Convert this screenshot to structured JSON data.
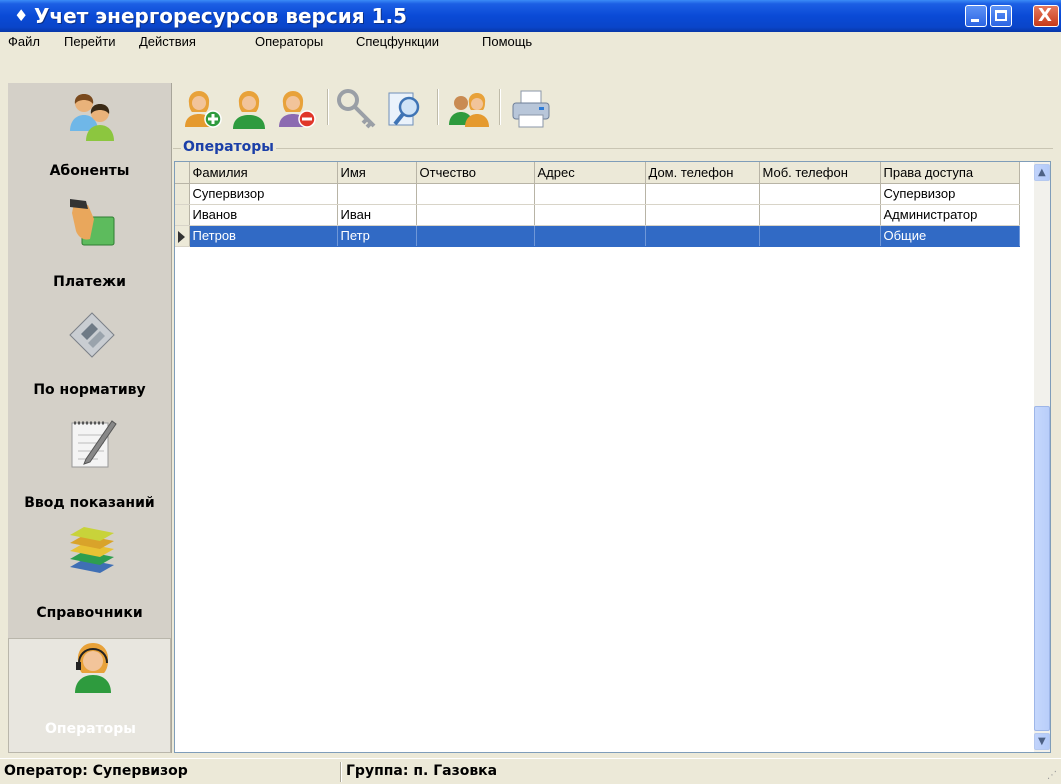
{
  "window": {
    "title": "Учет энергоресурсов версия 1.5",
    "close_glyph": "X"
  },
  "menu": [
    "Файл",
    "Перейти",
    "Действия",
    "Операторы",
    "Спецфункции",
    "Помощь"
  ],
  "nav": [
    {
      "label": "Абоненты",
      "icon": "subscribers-icon"
    },
    {
      "label": "Платежи",
      "icon": "payment-icon"
    },
    {
      "label": "По нормативу",
      "icon": "calculator-icon"
    },
    {
      "label": "Ввод показаний",
      "icon": "notepad-icon"
    },
    {
      "label": "Справочники",
      "icon": "books-icon"
    },
    {
      "label": "Операторы",
      "icon": "operator-icon",
      "active": true
    }
  ],
  "toolbar": {
    "buttons": [
      "add-operator-icon",
      "edit-operator-icon",
      "delete-operator-icon",
      "key-icon",
      "find-icon",
      "operator-group-icon",
      "printer-icon"
    ]
  },
  "group_title": "Операторы",
  "table": {
    "columns": [
      "Фамилия",
      "Имя",
      "Отчество",
      "Адрес",
      "Дом. телефон",
      "Моб. телефон",
      "Права доступа"
    ],
    "rows": [
      [
        "Супервизор",
        "",
        "",
        "",
        "",
        "",
        "Супервизор"
      ],
      [
        "Иванов",
        "Иван",
        "",
        "",
        "",
        "",
        "Администратор"
      ],
      [
        "Петров",
        "Петр",
        "",
        "",
        "",
        "",
        "Общие"
      ]
    ],
    "selected_row": 2
  },
  "status": {
    "operator": "Оператор: Супервизор",
    "group": "Группа: п. Газовка"
  }
}
